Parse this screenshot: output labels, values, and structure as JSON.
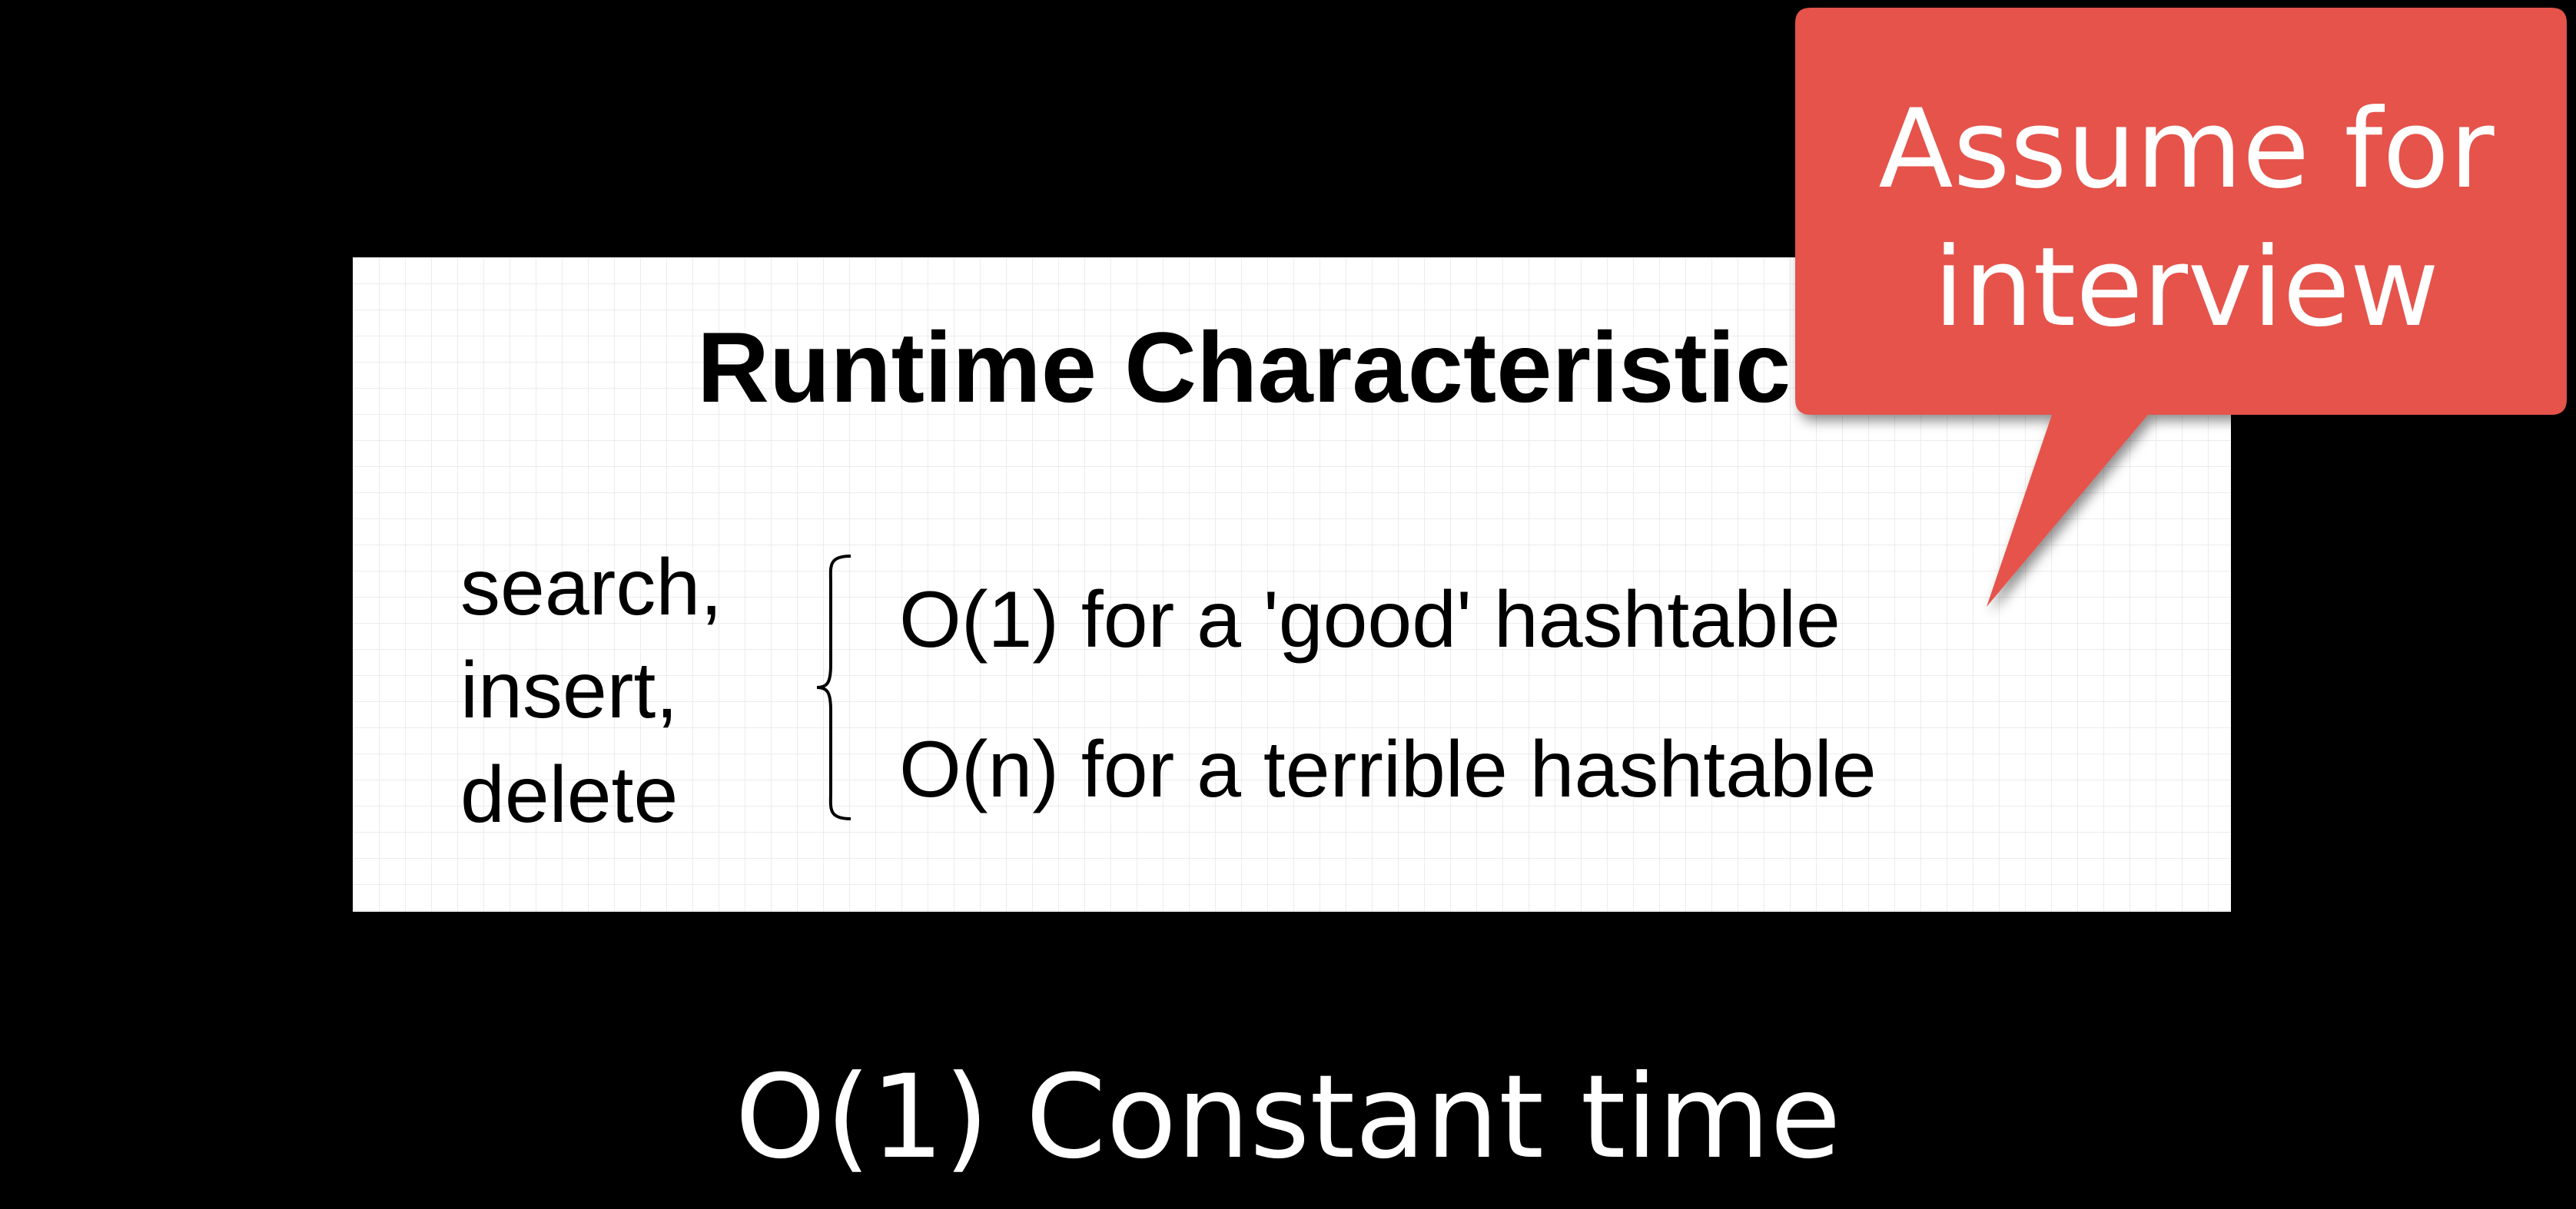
{
  "card": {
    "title": "Runtime Characteristic",
    "operations": [
      "search,",
      "insert,",
      "delete"
    ],
    "cases": [
      "O(1) for a 'good' hashtable",
      "O(n) for a terrible hashtable"
    ]
  },
  "callout": {
    "lines": [
      "Assume for",
      "interview"
    ],
    "color": "#e5534b"
  },
  "caption": "O(1) Constant time"
}
